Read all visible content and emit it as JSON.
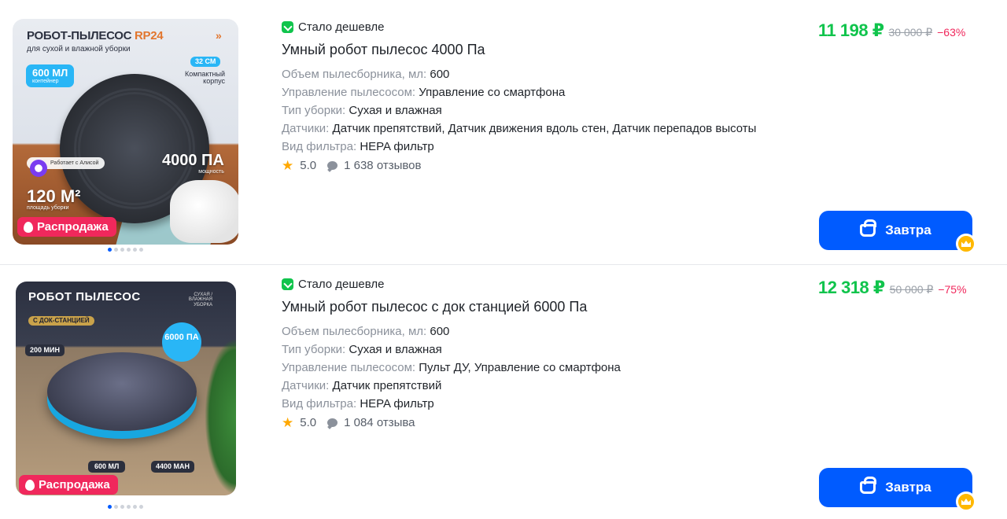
{
  "products": [
    {
      "badge": "Стало дешевле",
      "title": "Умный робот пылесос 4000 Па",
      "specs": [
        {
          "k": "Объем пылесборника, мл:",
          "v": "600"
        },
        {
          "k": "Управление пылесосом:",
          "v": "Управление со смартфона"
        },
        {
          "k": "Тип уборки:",
          "v": "Сухая и влажная"
        },
        {
          "k": "Датчики:",
          "v": "Датчик препятствий, Датчик движения вдоль стен, Датчик перепадов высоты"
        },
        {
          "k": "Вид фильтра:",
          "v": "HEPA фильтр"
        }
      ],
      "rating": "5.0",
      "reviews": "1 638 отзывов",
      "price_now": "11 198 ₽",
      "price_old": "30 000 ₽",
      "discount": "−63%",
      "buy_label": "Завтра",
      "sale_label": "Распродажа",
      "image": {
        "title_main": "РОБОТ-ПЫЛЕСОС",
        "title_accent": "RP24",
        "subtitle": "для сухой и влажной уборки",
        "chevrons": "»",
        "capacity": "600 МЛ",
        "capacity_sub": "контейнер",
        "size": "32 СМ",
        "compact": "Компактный корпус",
        "power": "4000 ПА",
        "power_sub": "мощность",
        "alisa": "Работает с Алисой",
        "area": "120 М²",
        "area_sub": "площадь уборки"
      }
    },
    {
      "badge": "Стало дешевле",
      "title": "Умный робот пылесос с док станцией 6000 Па",
      "specs": [
        {
          "k": "Объем пылесборника, мл:",
          "v": "600"
        },
        {
          "k": "Тип уборки:",
          "v": "Сухая и влажная"
        },
        {
          "k": "Управление пылесосом:",
          "v": "Пульт ДУ, Управление со смартфона"
        },
        {
          "k": "Датчики:",
          "v": "Датчик препятствий"
        },
        {
          "k": "Вид фильтра:",
          "v": "HEPA фильтр"
        }
      ],
      "rating": "5.0",
      "reviews": "1 084 отзыва",
      "price_now": "12 318 ₽",
      "price_old": "50 000 ₽",
      "discount": "−75%",
      "buy_label": "Завтра",
      "sale_label": "Распродажа",
      "image": {
        "title_main": "РОБОТ ПЫЛЕСОС",
        "dock": "С ДОК-СТАНЦИЕЙ",
        "dry_wet": "СУХАЯ / ВЛАЖНАЯ УБОРКА",
        "power": "6000 ПА",
        "runtime": "200 МИН",
        "capacity": "600 МЛ",
        "battery": "4400 MAH"
      }
    }
  ],
  "colors": {
    "price_green": "#10c44c",
    "discount_red": "#f0285c",
    "button_blue": "#005bff",
    "sale_pink": "#f0285c",
    "star": "#ffa800"
  }
}
